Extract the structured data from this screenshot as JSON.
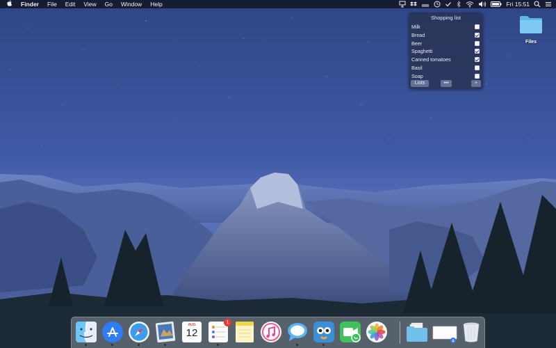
{
  "menubar": {
    "apple_icon": "apple-icon",
    "app_name": "Finder",
    "menus": [
      "File",
      "Edit",
      "View",
      "Go",
      "Window",
      "Help"
    ],
    "clock": "Fri 15:51",
    "status_icons": [
      "presentation-icon",
      "dropbox-icon",
      "menu-extra-icon",
      "clock-icon",
      "check-icon",
      "bluetooth-icon",
      "wifi-icon",
      "volume-icon",
      "battery-icon",
      "search-icon",
      "list-icon"
    ]
  },
  "widget": {
    "title": "Shopping list",
    "items": [
      {
        "label": "Milk",
        "checked": false
      },
      {
        "label": "Bread",
        "checked": true
      },
      {
        "label": "Beer",
        "checked": false
      },
      {
        "label": "Spaghetti",
        "checked": true
      },
      {
        "label": "Canned tomatoes",
        "checked": true
      },
      {
        "label": "Basil",
        "checked": false
      },
      {
        "label": "Soap",
        "checked": false
      }
    ],
    "lists_label": "Lists",
    "more_label": "•••",
    "add_label": "+"
  },
  "desktop": {
    "files_label": "Files"
  },
  "dock": {
    "apps": [
      "finder",
      "app-store",
      "safari",
      "preview",
      "calendar",
      "reminders",
      "notes",
      "itunes",
      "messages",
      "tweetbot",
      "facetime",
      "photos"
    ],
    "calendar_month": "AUG",
    "calendar_day": "12",
    "reminders_badge": "1",
    "colors": {
      "accent": "#2e7cf6",
      "badge": "#e83a30"
    }
  }
}
